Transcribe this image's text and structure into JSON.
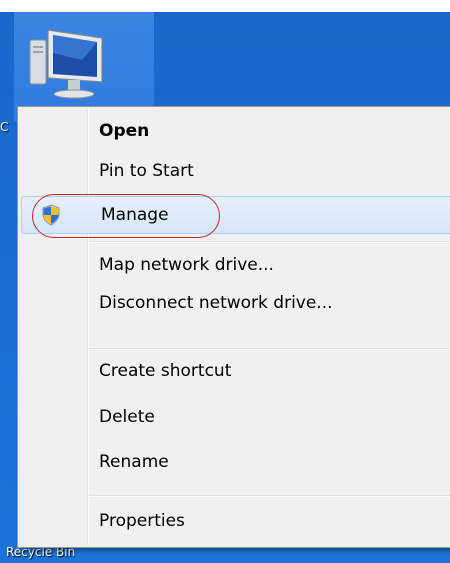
{
  "desktop": {
    "icon": "computer-icon",
    "recycle_bin_label": "Recycle Bin",
    "peek_label": "C"
  },
  "context_menu": {
    "items": [
      {
        "id": "open",
        "label": "Open",
        "bold": true
      },
      {
        "id": "pin-to-start",
        "label": "Pin to Start"
      },
      {
        "id": "manage",
        "label": "Manage",
        "icon": "uac-shield-icon",
        "highlighted": true
      },
      {
        "id": "map-network-drive",
        "label": "Map network drive..."
      },
      {
        "id": "disconnect-network-drive",
        "label": "Disconnect network drive..."
      },
      {
        "id": "create-shortcut",
        "label": "Create shortcut"
      },
      {
        "id": "delete",
        "label": "Delete"
      },
      {
        "id": "rename",
        "label": "Rename"
      },
      {
        "id": "properties",
        "label": "Properties"
      }
    ],
    "highlight_color": "#d5e6f8",
    "annotation_color": "#c22a2a"
  }
}
